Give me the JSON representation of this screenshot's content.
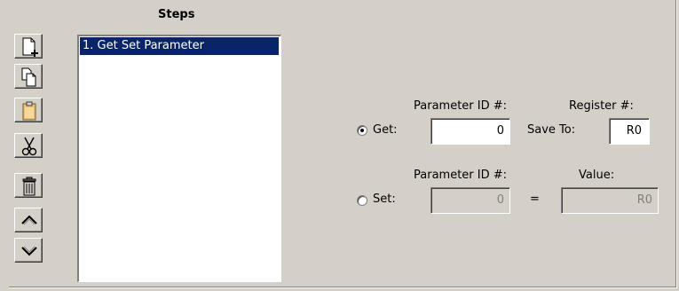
{
  "steps": {
    "title": "Steps",
    "items": [
      {
        "label": "1. Get Set Parameter",
        "selected": true
      }
    ]
  },
  "toolbar": {
    "buttons": [
      {
        "name": "new-step-icon"
      },
      {
        "name": "copy-icon"
      },
      {
        "name": "paste-icon"
      },
      {
        "name": "cut-icon"
      },
      {
        "name": "delete-icon"
      },
      {
        "name": "move-up-icon"
      },
      {
        "name": "move-down-icon"
      }
    ]
  },
  "get": {
    "radio_label": "Get:",
    "selected": true,
    "param_id_label": "Parameter ID #:",
    "param_id_value": "0",
    "register_label": "Register #:",
    "save_to_label": "Save To:",
    "register_value": "R0"
  },
  "set": {
    "radio_label": "Set:",
    "selected": false,
    "param_id_label": "Parameter ID #:",
    "param_id_value": "0",
    "equals": "=",
    "value_label": "Value:",
    "value_value": "R0"
  },
  "colors": {
    "background": "#d4d0c8",
    "selection": "#0a246a",
    "disabled_text": "#808080"
  }
}
